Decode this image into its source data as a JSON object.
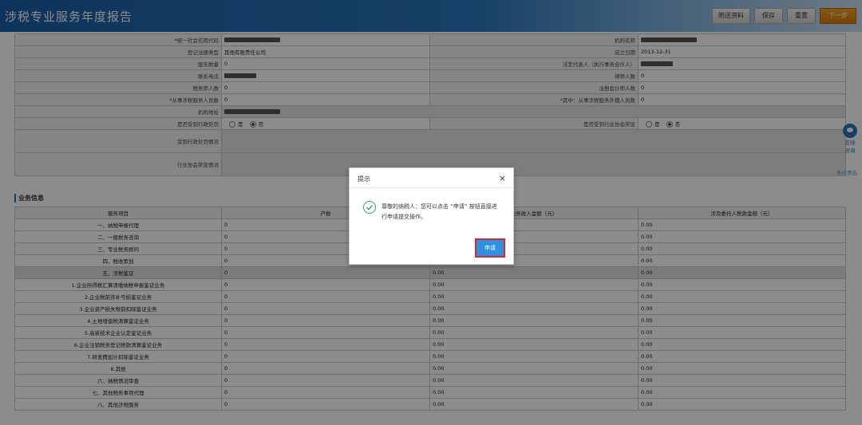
{
  "header": {
    "title": "涉税专业服务年度报告",
    "buttons": [
      "附送资料",
      "保存",
      "重置",
      "下一步"
    ]
  },
  "info": {
    "rows": [
      {
        "l1": "*统一社会信用代码",
        "v1": "",
        "l2": "机构名称",
        "v2": ""
      },
      {
        "l1": "登记注册类型",
        "v1": "其他有限责任公司",
        "l2": "成立日期",
        "v2": "2013-12-31"
      },
      {
        "l1": "股东数量",
        "v1": "0",
        "l2": "法定代表人（执行事务合伙人）",
        "v2": ""
      },
      {
        "l1": "联系电话",
        "v1": "",
        "l2": "律师人数",
        "v2": "0"
      },
      {
        "l1": "税务师人数",
        "v1": "0",
        "l2": "注册会计师人数",
        "v2": "0"
      },
      {
        "l1": "*从事涉税服务人员数",
        "v1": "0",
        "l2": "*其中：从事涉税服务外籍人员数",
        "v2": "0"
      }
    ],
    "address_label": "机构地址",
    "penalty_label": "是否受到行政处罚",
    "assoc_label": "是否受到行业协会奖惩",
    "yes": "是",
    "no": "否",
    "penalty_detail_label": "受到行政处罚情况",
    "assoc_detail_label": "行业协会奖惩情况"
  },
  "business": {
    "title": "业务信息",
    "headers": [
      "服务项目",
      "户数",
      "业务收入金额（元）",
      "涉及委托人税款金额（元）"
    ],
    "rows": [
      {
        "name": "一、纳税申报代理",
        "c1": "0",
        "c2": "",
        "c3": "0.00"
      },
      {
        "name": "二、一般税务咨询",
        "c1": "0",
        "c2": "",
        "c3": "0.00"
      },
      {
        "name": "三、专业税务顾问",
        "c1": "0",
        "c2": "",
        "c3": "0.00"
      },
      {
        "name": "四、税收策划",
        "c1": "0",
        "c2": "",
        "c3": "0.00"
      },
      {
        "name": "五、涉税鉴证",
        "c1": "0",
        "c2": "0.00",
        "c3": "0.00"
      },
      {
        "name": "1.企业所得税汇算清缴纳税申报鉴证业务",
        "c1": "0",
        "c2": "0.00",
        "c3": "0.00"
      },
      {
        "name": "2.企业税前弥补亏损鉴证业务",
        "c1": "0",
        "c2": "0.00",
        "c3": "0.00"
      },
      {
        "name": "3.企业资产损失税前扣除鉴证业务",
        "c1": "0",
        "c2": "0.00",
        "c3": "0.00"
      },
      {
        "name": "4.土地增值税清算鉴证业务",
        "c1": "0",
        "c2": "0.00",
        "c3": "0.00"
      },
      {
        "name": "5.高新技术企业认定鉴证业务",
        "c1": "0",
        "c2": "0.00",
        "c3": "0.00"
      },
      {
        "name": "6.企业注销税务登记税款清算鉴证业务",
        "c1": "0",
        "c2": "0.00",
        "c3": "0.00"
      },
      {
        "name": "7.研发费加计扣除鉴证业务",
        "c1": "0",
        "c2": "0.00",
        "c3": "0.00"
      },
      {
        "name": "8.其他",
        "c1": "0",
        "c2": "0.00",
        "c3": "0.00"
      },
      {
        "name": "六、纳税情况审查",
        "c1": "0",
        "c2": "0.00",
        "c3": "0.00"
      },
      {
        "name": "七、其他税务事项代理",
        "c1": "0",
        "c2": "0.00",
        "c3": "0.00"
      },
      {
        "name": "八、其他涉税服务",
        "c1": "0",
        "c2": "0.00",
        "c3": "0.00"
      }
    ]
  },
  "dialog": {
    "title": "提示",
    "close": "×",
    "message": "尊敬的纳税人：您可以点击 “申请” 按钮直接进行申请提交操作。",
    "apply": "申请"
  },
  "side": {
    "online_line1": "在线",
    "online_line2": "咨询",
    "extra": "条优惠选"
  },
  "colors": {
    "header": "#2a76bd",
    "next_button": "#e08a14",
    "apply_button": "#2f8fe0",
    "highlight": "#e0242c",
    "success": "#3aa45a"
  }
}
